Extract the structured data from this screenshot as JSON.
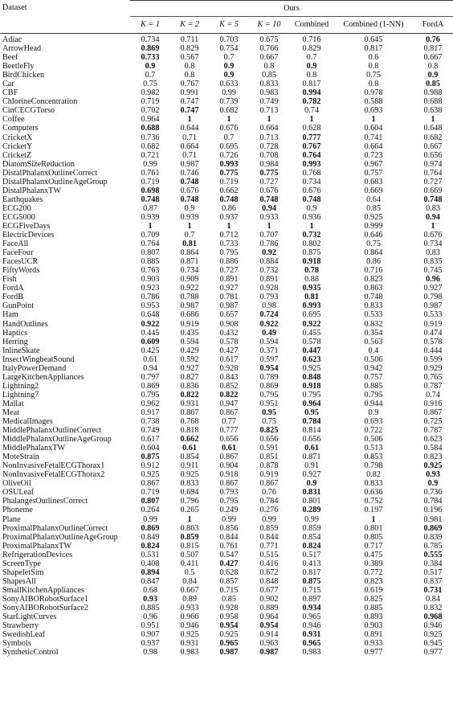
{
  "table": {
    "dataset_header": "Dataset",
    "group_header": "Ours",
    "columns": [
      "K = 1",
      "K = 2",
      "K = 5",
      "K = 10",
      "Combined",
      "Combined (1-NN)",
      "FordA"
    ],
    "rows": [
      {
        "name": "Adiac",
        "values": [
          "0.734",
          "0.711",
          "0.703",
          "0.675",
          "0.716",
          "0.645",
          "0.76"
        ],
        "bold": [
          6
        ]
      },
      {
        "name": "ArrowHead",
        "values": [
          "0.869",
          "0.829",
          "0.754",
          "0.766",
          "0.829",
          "0.817",
          "0.817"
        ],
        "bold": [
          0
        ]
      },
      {
        "name": "Beef",
        "values": [
          "0.733",
          "0.567",
          "0.7",
          "0.667",
          "0.7",
          "0.6",
          "0.667"
        ],
        "bold": [
          0
        ]
      },
      {
        "name": "BeetleFly",
        "values": [
          "0.9",
          "0.8",
          "0.9",
          "0.8",
          "0.9",
          "0.8",
          "0.8"
        ],
        "bold": [
          0,
          2,
          4
        ]
      },
      {
        "name": "BirdChicken",
        "values": [
          "0.7",
          "0.8",
          "0.9",
          "0.85",
          "0.8",
          "0.75",
          "0.9"
        ],
        "bold": [
          2,
          6
        ]
      },
      {
        "name": "Car",
        "values": [
          "0.75",
          "0.767",
          "0.633",
          "0.833",
          "0.817",
          "0.8",
          "0.85"
        ],
        "bold": [
          6
        ]
      },
      {
        "name": "CBF",
        "values": [
          "0.982",
          "0.991",
          "0.99",
          "0.983",
          "0.994",
          "0.978",
          "0.988"
        ],
        "bold": [
          4
        ]
      },
      {
        "name": "ChlorineConcentration",
        "values": [
          "0.719",
          "0.747",
          "0.739",
          "0.749",
          "0.782",
          "0.588",
          "0.688"
        ],
        "bold": [
          4
        ]
      },
      {
        "name": "CinCECGTorso",
        "values": [
          "0.702",
          "0.747",
          "0.682",
          "0.713",
          "0.74",
          "0.693",
          "0.638"
        ],
        "bold": [
          1
        ]
      },
      {
        "name": "Coffee",
        "values": [
          "0.964",
          "1",
          "1",
          "1",
          "1",
          "1",
          "1"
        ],
        "bold": [
          1,
          2,
          3,
          4,
          5,
          6
        ]
      },
      {
        "name": "Computers",
        "values": [
          "0.688",
          "0.644",
          "0.676",
          "0.664",
          "0.628",
          "0.604",
          "0.648"
        ],
        "bold": [
          0
        ]
      },
      {
        "name": "CricketX",
        "values": [
          "0.736",
          "0.71",
          "0.7",
          "0.713",
          "0.777",
          "0.741",
          "0.682"
        ],
        "bold": [
          4
        ]
      },
      {
        "name": "CricketY",
        "values": [
          "0.682",
          "0.664",
          "0.695",
          "0.728",
          "0.767",
          "0.664",
          "0.667"
        ],
        "bold": [
          4
        ]
      },
      {
        "name": "CricketZ",
        "values": [
          "0.721",
          "0.71",
          "0.726",
          "0.708",
          "0.764",
          "0.723",
          "0.656"
        ],
        "bold": [
          4
        ]
      },
      {
        "name": "DiatomSizeReduction",
        "values": [
          "0.99",
          "0.987",
          "0.993",
          "0.984",
          "0.993",
          "0.967",
          "0.974"
        ],
        "bold": [
          2,
          4
        ]
      },
      {
        "name": "DistalPhalanxOutlineCorrect",
        "values": [
          "0.761",
          "0.746",
          "0.775",
          "0.775",
          "0.768",
          "0.757",
          "0.764"
        ],
        "bold": [
          2,
          3
        ]
      },
      {
        "name": "DistalPhalanxOutlineAgeGroup",
        "values": [
          "0.719",
          "0.748",
          "0.719",
          "0.727",
          "0.734",
          "0.683",
          "0.727"
        ],
        "bold": [
          1
        ]
      },
      {
        "name": "DistalPhalanxTW",
        "values": [
          "0.698",
          "0.676",
          "0.662",
          "0.676",
          "0.676",
          "0.669",
          "0.669"
        ],
        "bold": [
          0
        ]
      },
      {
        "name": "Earthquakes",
        "values": [
          "0.748",
          "0.748",
          "0.748",
          "0.748",
          "0.748",
          "0.64",
          "0.748"
        ],
        "bold": [
          0,
          1,
          2,
          3,
          4,
          6
        ]
      },
      {
        "name": "ECG200",
        "values": [
          "0.87",
          "0.9",
          "0.86",
          "0.94",
          "0.9",
          "0.85",
          "0.83"
        ],
        "bold": [
          3
        ]
      },
      {
        "name": "ECG5000",
        "values": [
          "0.939",
          "0.939",
          "0.937",
          "0.933",
          "0.936",
          "0.925",
          "0.94"
        ],
        "bold": [
          6
        ]
      },
      {
        "name": "ECGFiveDays",
        "values": [
          "1",
          "1",
          "1",
          "1",
          "1",
          "0.999",
          "1"
        ],
        "bold": [
          0,
          1,
          2,
          3,
          4,
          6
        ]
      },
      {
        "name": "ElectricDevices",
        "values": [
          "0.709",
          "0.7",
          "0.712",
          "0.707",
          "0.732",
          "0.646",
          "0.676"
        ],
        "bold": [
          4
        ]
      },
      {
        "name": "FaceAll",
        "values": [
          "0.764",
          "0.81",
          "0.733",
          "0.786",
          "0.802",
          "0.75",
          "0.734"
        ],
        "bold": [
          1
        ]
      },
      {
        "name": "FaceFour",
        "values": [
          "0.807",
          "0.864",
          "0.795",
          "0.92",
          "0.875",
          "0.864",
          "0.83"
        ],
        "bold": [
          3
        ]
      },
      {
        "name": "FacesUCR",
        "values": [
          "0.885",
          "0.871",
          "0.886",
          "0.884",
          "0.918",
          "0.86",
          "0.835"
        ],
        "bold": [
          4
        ]
      },
      {
        "name": "FiftyWords",
        "values": [
          "0.763",
          "0.734",
          "0.727",
          "0.732",
          "0.78",
          "0.716",
          "0.745"
        ],
        "bold": [
          4
        ]
      },
      {
        "name": "Fish",
        "values": [
          "0.903",
          "0.909",
          "0.891",
          "0.891",
          "0.88",
          "0.823",
          "0.96"
        ],
        "bold": [
          6
        ]
      },
      {
        "name": "FordA",
        "values": [
          "0.923",
          "0.922",
          "0.927",
          "0.928",
          "0.935",
          "0.863",
          "0.927"
        ],
        "bold": [
          4
        ]
      },
      {
        "name": "FordB",
        "values": [
          "0.786",
          "0.788",
          "0.781",
          "0.793",
          "0.81",
          "0.748",
          "0.798"
        ],
        "bold": [
          4
        ]
      },
      {
        "name": "GunPoint",
        "values": [
          "0.953",
          "0.987",
          "0.987",
          "0.98",
          "0.993",
          "0.833",
          "0.987"
        ],
        "bold": [
          4
        ]
      },
      {
        "name": "Ham",
        "values": [
          "0.648",
          "0.686",
          "0.657",
          "0.724",
          "0.695",
          "0.533",
          "0.533"
        ],
        "bold": [
          3
        ]
      },
      {
        "name": "HandOutlines",
        "values": [
          "0.922",
          "0.919",
          "0.908",
          "0.922",
          "0.922",
          "0.832",
          "0.919"
        ],
        "bold": [
          0,
          3,
          4
        ]
      },
      {
        "name": "Haptics",
        "values": [
          "0.445",
          "0.435",
          "0.432",
          "0.49",
          "0.455",
          "0.354",
          "0.474"
        ],
        "bold": [
          3
        ]
      },
      {
        "name": "Herring",
        "values": [
          "0.609",
          "0.594",
          "0.578",
          "0.594",
          "0.578",
          "0.563",
          "0.578"
        ],
        "bold": [
          0
        ]
      },
      {
        "name": "InlineSkate",
        "values": [
          "0.425",
          "0.429",
          "0.427",
          "0.371",
          "0.447",
          "0.4",
          "0.444"
        ],
        "bold": [
          4
        ]
      },
      {
        "name": "InsectWingbeatSound",
        "values": [
          "0.61",
          "0.592",
          "0.617",
          "0.597",
          "0.623",
          "0.506",
          "0.599"
        ],
        "bold": [
          4
        ]
      },
      {
        "name": "ItalyPowerDemand",
        "values": [
          "0.94",
          "0.927",
          "0.928",
          "0.954",
          "0.925",
          "0.942",
          "0.929"
        ],
        "bold": [
          3
        ]
      },
      {
        "name": "LargeKitchenAppliances",
        "values": [
          "0.797",
          "0.827",
          "0.843",
          "0.789",
          "0.848",
          "0.757",
          "0.765"
        ],
        "bold": [
          4
        ]
      },
      {
        "name": "Lightning2",
        "values": [
          "0.869",
          "0.836",
          "0.852",
          "0.869",
          "0.918",
          "0.885",
          "0.787"
        ],
        "bold": [
          4
        ]
      },
      {
        "name": "Lightning7",
        "values": [
          "0.795",
          "0.822",
          "0.822",
          "0.795",
          "0.795",
          "0.795",
          "0.74"
        ],
        "bold": [
          1,
          2
        ]
      },
      {
        "name": "Mallat",
        "values": [
          "0.962",
          "0.931",
          "0.947",
          "0.951",
          "0.964",
          "0.944",
          "0.916"
        ],
        "bold": [
          4
        ]
      },
      {
        "name": "Meat",
        "values": [
          "0.917",
          "0.867",
          "0.867",
          "0.95",
          "0.95",
          "0.9",
          "0.867"
        ],
        "bold": [
          3,
          4
        ]
      },
      {
        "name": "MedicalImages",
        "values": [
          "0.738",
          "0.768",
          "0.77",
          "0.75",
          "0.784",
          "0.693",
          "0.725"
        ],
        "bold": [
          4
        ]
      },
      {
        "name": "MiddlePhalanxOutlineCorrect",
        "values": [
          "0.749",
          "0.818",
          "0.777",
          "0.825",
          "0.814",
          "0.722",
          "0.787"
        ],
        "bold": [
          3
        ]
      },
      {
        "name": "MiddlePhalanxOutlineAgeGroup",
        "values": [
          "0.617",
          "0.662",
          "0.656",
          "0.656",
          "0.656",
          "0.506",
          "0.623"
        ],
        "bold": [
          1
        ]
      },
      {
        "name": "MiddlePhalanxTW",
        "values": [
          "0.604",
          "0.61",
          "0.61",
          "0.591",
          "0.61",
          "0.513",
          "0.584"
        ],
        "bold": [
          1,
          2,
          4
        ]
      },
      {
        "name": "MoteStrain",
        "values": [
          "0.875",
          "0.854",
          "0.867",
          "0.851",
          "0.871",
          "0.853",
          "0.823"
        ],
        "bold": [
          0
        ]
      },
      {
        "name": "NonInvasiveFetalECGThorax1",
        "values": [
          "0.912",
          "0.911",
          "0.904",
          "0.878",
          "0.91",
          "0.798",
          "0.925"
        ],
        "bold": [
          6
        ]
      },
      {
        "name": "NonInvasiveFetalECGThorax2",
        "values": [
          "0.925",
          "0.925",
          "0.918",
          "0.919",
          "0.927",
          "0.82",
          "0.93"
        ],
        "bold": [
          6
        ]
      },
      {
        "name": "OliveOil",
        "values": [
          "0.867",
          "0.833",
          "0.867",
          "0.867",
          "0.9",
          "0.833",
          "0.9"
        ],
        "bold": [
          4,
          6
        ]
      },
      {
        "name": "OSULeaf",
        "values": [
          "0.719",
          "0.694",
          "0.793",
          "0.76",
          "0.831",
          "0.636",
          "0.736"
        ],
        "bold": [
          4
        ]
      },
      {
        "name": "PhalangesOutlinesCorrect",
        "values": [
          "0.807",
          "0.796",
          "0.795",
          "0.784",
          "0.801",
          "0.752",
          "0.784"
        ],
        "bold": [
          0
        ]
      },
      {
        "name": "Phoneme",
        "values": [
          "0.264",
          "0.265",
          "0.249",
          "0.276",
          "0.289",
          "0.197",
          "0.196"
        ],
        "bold": [
          4
        ]
      },
      {
        "name": "Plane",
        "values": [
          "0.99",
          "1",
          "0.99",
          "0.99",
          "0.99",
          "1",
          "0.981"
        ],
        "bold": [
          1,
          5
        ]
      },
      {
        "name": "ProximalPhalanxOutlineCorrect",
        "values": [
          "0.869",
          "0.863",
          "0.856",
          "0.859",
          "0.859",
          "0.801",
          "0.869"
        ],
        "bold": [
          0,
          6
        ]
      },
      {
        "name": "ProximalPhalanxOutlineAgeGroup",
        "values": [
          "0.849",
          "0.859",
          "0.844",
          "0.844",
          "0.854",
          "0.805",
          "0.839"
        ],
        "bold": [
          1
        ]
      },
      {
        "name": "ProximalPhalanxTW",
        "values": [
          "0.824",
          "0.815",
          "0.761",
          "0.771",
          "0.824",
          "0.717",
          "0.785"
        ],
        "bold": [
          0,
          4
        ]
      },
      {
        "name": "RefrigerationDevices",
        "values": [
          "0.531",
          "0.507",
          "0.547",
          "0.515",
          "0.517",
          "0.475",
          "0.555"
        ],
        "bold": [
          6
        ]
      },
      {
        "name": "ScreenType",
        "values": [
          "0.408",
          "0.411",
          "0.427",
          "0.416",
          "0.413",
          "0.389",
          "0.384"
        ],
        "bold": [
          2
        ]
      },
      {
        "name": "ShapeletSim",
        "values": [
          "0.894",
          "0.5",
          "0.628",
          "0.672",
          "0.817",
          "0.772",
          "0.517"
        ],
        "bold": [
          0
        ]
      },
      {
        "name": "ShapesAll",
        "values": [
          "0.847",
          "0.84",
          "0.857",
          "0.848",
          "0.875",
          "0.823",
          "0.837"
        ],
        "bold": [
          4
        ]
      },
      {
        "name": "SmallKitchenAppliances",
        "values": [
          "0.68",
          "0.667",
          "0.715",
          "0.677",
          "0.715",
          "0.619",
          "0.731"
        ],
        "bold": [
          6
        ]
      },
      {
        "name": "SonyAIBORobotSurface1",
        "values": [
          "0.93",
          "0.89",
          "0.85",
          "0.902",
          "0.897",
          "0.825",
          "0.84"
        ],
        "bold": [
          0
        ]
      },
      {
        "name": "SonyAIBORobotSurface2",
        "values": [
          "0.885",
          "0.933",
          "0.928",
          "0.889",
          "0.934",
          "0.885",
          "0.832"
        ],
        "bold": [
          4
        ]
      },
      {
        "name": "StarLightCurves",
        "values": [
          "0.96",
          "0.966",
          "0.958",
          "0.964",
          "0.965",
          "0.893",
          "0.968"
        ],
        "bold": [
          6
        ]
      },
      {
        "name": "Strawberry",
        "values": [
          "0.951",
          "0.946",
          "0.954",
          "0.954",
          "0.946",
          "0.903",
          "0.946"
        ],
        "bold": [
          2,
          3
        ]
      },
      {
        "name": "SwedishLeaf",
        "values": [
          "0.907",
          "0.925",
          "0.925",
          "0.914",
          "0.931",
          "0.891",
          "0.925"
        ],
        "bold": [
          4
        ]
      },
      {
        "name": "Symbols",
        "values": [
          "0.937",
          "0.931",
          "0.965",
          "0.963",
          "0.965",
          "0.933",
          "0.945"
        ],
        "bold": [
          2,
          4
        ]
      },
      {
        "name": "SyntheticControl",
        "values": [
          "0.98",
          "0.983",
          "0.987",
          "0.987",
          "0.983",
          "0.977",
          "0.977"
        ],
        "bold": [
          2,
          3
        ]
      }
    ]
  }
}
